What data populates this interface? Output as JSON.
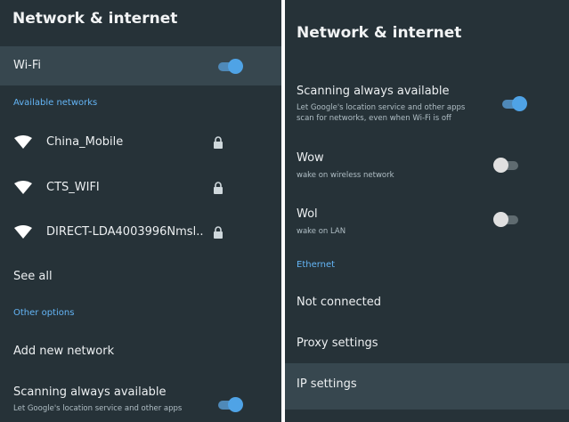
{
  "left": {
    "title": "Network & internet",
    "wifi": {
      "label": "Wi-Fi",
      "enabled": true
    },
    "available_header": "Available networks",
    "networks": [
      {
        "ssid": "China_Mobile",
        "secured": true
      },
      {
        "ssid": "CTS_WIFI",
        "secured": true
      },
      {
        "ssid": "DIRECT-LDA4003996Nmsl..",
        "secured": true
      }
    ],
    "see_all": "See all",
    "other_header": "Other options",
    "add_network": "Add new network",
    "scanning": {
      "label": "Scanning always available",
      "desc": "Let Google's location service and other apps",
      "enabled": true
    }
  },
  "right": {
    "title": "Network & internet",
    "scanning": {
      "label": "Scanning always available",
      "desc_line1": "Let Google's location service and other apps",
      "desc_line2": "scan for networks, even when Wi-Fi is off",
      "enabled": true
    },
    "wow": {
      "label": "Wow",
      "desc": "wake on wireless network",
      "enabled": false
    },
    "wol": {
      "label": "Wol",
      "desc": "wake on LAN",
      "enabled": false
    },
    "ethernet_header": "Ethernet",
    "not_connected": "Not connected",
    "proxy_settings": "Proxy settings",
    "ip_settings": "IP settings"
  },
  "colors": {
    "panel_bg": "#263238",
    "highlight_bg": "#37474f",
    "accent": "#64b5f6",
    "toggle_on": "#4fa3e6"
  }
}
